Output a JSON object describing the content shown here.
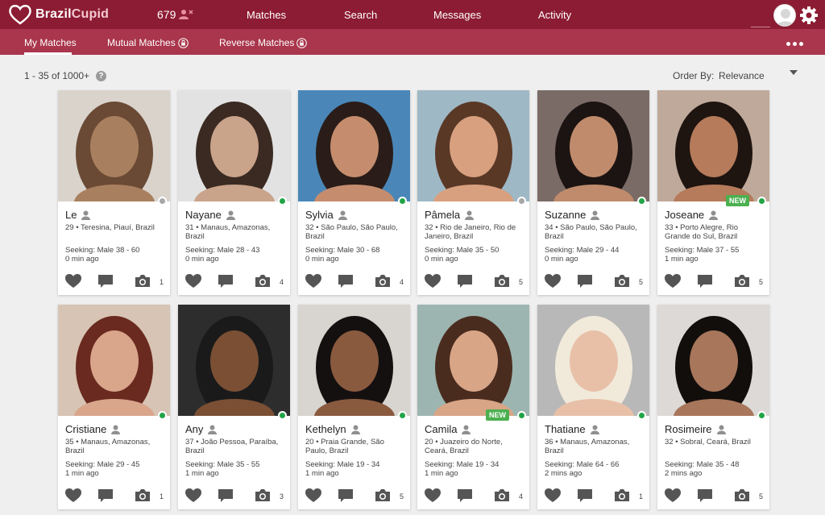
{
  "brand": {
    "name_a": "Brazil",
    "name_b": "Cupid"
  },
  "header": {
    "count": "679",
    "nav": [
      "Matches",
      "Search",
      "Messages",
      "Activity"
    ]
  },
  "subnav": {
    "tabs": [
      "My Matches",
      "Mutual Matches",
      "Reverse Matches"
    ]
  },
  "results": {
    "summary": "1 - 35 of 1000+",
    "help": "?",
    "order_label": "Order By:",
    "order_value": "Relevance"
  },
  "profiles": [
    {
      "name": "Le",
      "location": "29 • Teresina, Piauí, Brazil",
      "seeking": "Seeking: Male 38 - 60",
      "ago": "0 min ago",
      "photos": "1",
      "online": false,
      "new": ""
    },
    {
      "name": "Nayane",
      "location": "31 • Manaus, Amazonas, Brazil",
      "seeking": "Seeking: Male 28 - 43",
      "ago": "0 min ago",
      "photos": "4",
      "online": true,
      "new": ""
    },
    {
      "name": "Sylvia",
      "location": "32 • São Paulo, São Paulo, Brazil",
      "seeking": "Seeking: Male 30 - 68",
      "ago": "0 min ago",
      "photos": "4",
      "online": true,
      "new": ""
    },
    {
      "name": "Pâmela",
      "location": "32 • Rio de Janeiro, Rio de Janeiro, Brazil",
      "seeking": "Seeking: Male 35 - 50",
      "ago": "0 min ago",
      "photos": "5",
      "online": false,
      "new": ""
    },
    {
      "name": "Suzanne",
      "location": "34 • São Paulo, São Paulo, Brazil",
      "seeking": "Seeking: Male 29 - 44",
      "ago": "0 min ago",
      "photos": "5",
      "online": true,
      "new": ""
    },
    {
      "name": "Joseane",
      "location": "33 • Porto Alegre, Rio Grande do Sul, Brazil",
      "seeking": "Seeking: Male 37 - 55",
      "ago": "1 min ago",
      "photos": "5",
      "online": true,
      "new": "NEW"
    },
    {
      "name": "Cristiane",
      "location": "35 • Manaus, Amazonas, Brazil",
      "seeking": "Seeking: Male 29 - 45",
      "ago": "1 min ago",
      "photos": "1",
      "online": true,
      "new": ""
    },
    {
      "name": "Any",
      "location": "37 • João Pessoa, Paraíba, Brazil",
      "seeking": "Seeking: Male 35 - 55",
      "ago": "1 min ago",
      "photos": "3",
      "online": true,
      "new": ""
    },
    {
      "name": "Kethelyn",
      "location": "20 • Praia Grande, São Paulo, Brazil",
      "seeking": "Seeking: Male 19 - 34",
      "ago": "1 min ago",
      "photos": "5",
      "online": true,
      "new": ""
    },
    {
      "name": "Camila",
      "location": "20 • Juazeiro do Norte, Ceará, Brazil",
      "seeking": "Seeking: Male 19 - 34",
      "ago": "1 min ago",
      "photos": "4",
      "online": true,
      "new": "NEW"
    },
    {
      "name": "Thatiane",
      "location": "36 • Manaus, Amazonas, Brazil",
      "seeking": "Seeking: Male 64 - 66",
      "ago": "2 mins ago",
      "photos": "1",
      "online": true,
      "new": ""
    },
    {
      "name": "Rosimeire",
      "location": "32 • Sobral, Ceará, Brazil",
      "seeking": "Seeking: Male 35 - 48",
      "ago": "2 mins ago",
      "photos": "5",
      "online": true,
      "new": ""
    }
  ],
  "colors": {
    "topbar": "#8c1c33",
    "subbar": "#a9364c",
    "online": "#22a447",
    "offline": "#a7a7a7",
    "new_badge": "#4cb050"
  },
  "icons": {
    "like": "heart-icon",
    "message": "chat-bubble-icon",
    "photos": "camera-icon",
    "verified": "person-icon"
  }
}
